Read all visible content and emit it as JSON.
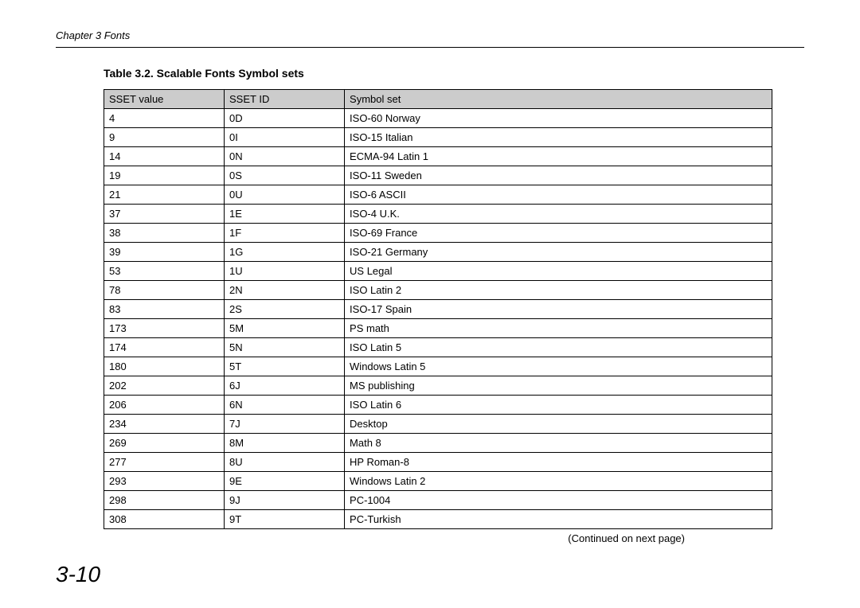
{
  "header": {
    "chapter": "Chapter 3  Fonts"
  },
  "table_title": "Table 3.2. Scalable Fonts Symbol sets",
  "columns": {
    "sset_value": "SSET value",
    "sset_id": "SSET ID",
    "symbol_set": "Symbol set"
  },
  "rows": [
    {
      "value": "4",
      "id": "0D",
      "set": "ISO-60 Norway"
    },
    {
      "value": "9",
      "id": "0I",
      "set": "ISO-15 Italian"
    },
    {
      "value": "14",
      "id": "0N",
      "set": "ECMA-94 Latin 1"
    },
    {
      "value": "19",
      "id": "0S",
      "set": "ISO-11 Sweden"
    },
    {
      "value": "21",
      "id": "0U",
      "set": "ISO-6 ASCII"
    },
    {
      "value": "37",
      "id": "1E",
      "set": "ISO-4 U.K."
    },
    {
      "value": "38",
      "id": "1F",
      "set": "ISO-69 France"
    },
    {
      "value": "39",
      "id": "1G",
      "set": "ISO-21 Germany"
    },
    {
      "value": "53",
      "id": "1U",
      "set": "US Legal"
    },
    {
      "value": "78",
      "id": "2N",
      "set": "ISO Latin 2"
    },
    {
      "value": "83",
      "id": "2S",
      "set": "ISO-17 Spain"
    },
    {
      "value": "173",
      "id": "5M",
      "set": "PS math"
    },
    {
      "value": "174",
      "id": "5N",
      "set": "ISO Latin 5"
    },
    {
      "value": "180",
      "id": "5T",
      "set": "Windows Latin 5"
    },
    {
      "value": "202",
      "id": "6J",
      "set": "MS publishing"
    },
    {
      "value": "206",
      "id": "6N",
      "set": "ISO Latin 6"
    },
    {
      "value": "234",
      "id": "7J",
      "set": "Desktop"
    },
    {
      "value": "269",
      "id": "8M",
      "set": "Math 8"
    },
    {
      "value": "277",
      "id": "8U",
      "set": "HP Roman-8"
    },
    {
      "value": "293",
      "id": "9E",
      "set": "Windows Latin 2"
    },
    {
      "value": "298",
      "id": "9J",
      "set": "PC-1004"
    },
    {
      "value": "308",
      "id": "9T",
      "set": "PC-Turkish"
    }
  ],
  "continued": "(Continued on next page)",
  "page_number": "3-10"
}
